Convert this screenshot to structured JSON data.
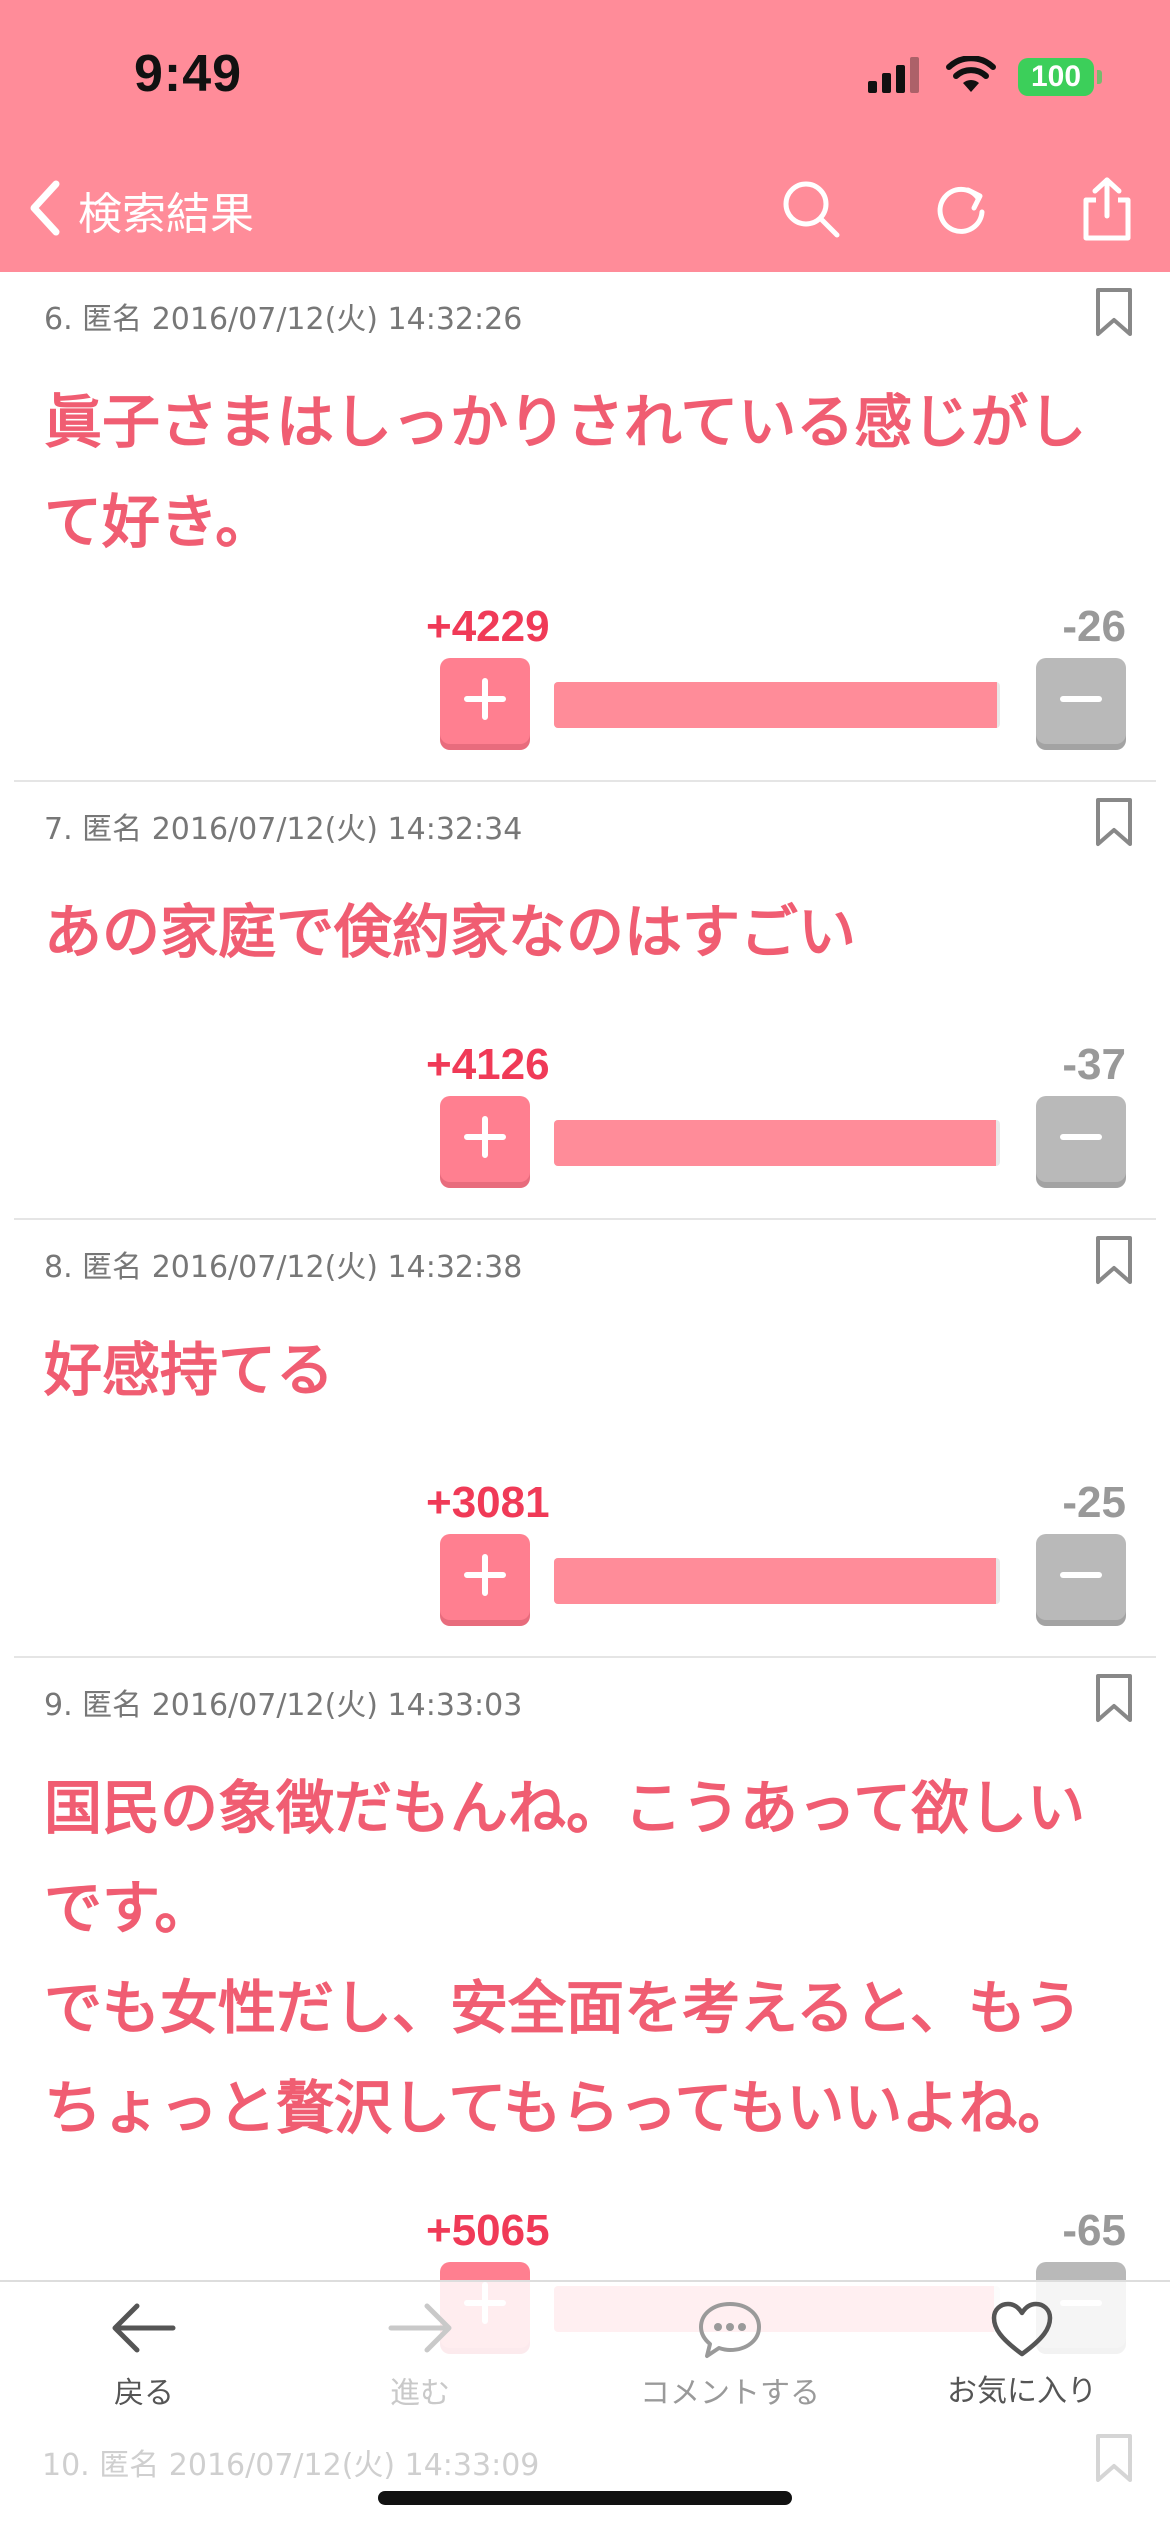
{
  "status": {
    "time": "9:49",
    "battery": "100"
  },
  "nav": {
    "back_title": "検索結果"
  },
  "comments": [
    {
      "meta": "6. 匿名 2016/07/12(火) 14:32:26",
      "text": "眞子さまはしっかりされている感じがして好き。",
      "plus": "+4229",
      "minus": "-26",
      "ratio": 0.994
    },
    {
      "meta": "7. 匿名 2016/07/12(火) 14:32:34",
      "text": "あの家庭で倹約家なのはすごい",
      "plus": "+4126",
      "minus": "-37",
      "ratio": 0.991
    },
    {
      "meta": "8. 匿名 2016/07/12(火) 14:32:38",
      "text": "好感持てる",
      "plus": "+3081",
      "minus": "-25",
      "ratio": 0.992
    },
    {
      "meta": "9. 匿名 2016/07/12(火) 14:33:03",
      "text": "国民の象徴だもんね。こうあって欲しいです。\nでも女性だし、安全面を考えると、もうちょっと贅沢してもらってもいいよね。",
      "plus": "+5065",
      "minus": "-65",
      "ratio": 0.987
    }
  ],
  "peek": {
    "meta": "10. 匿名 2016/07/12(火) 14:33:09"
  },
  "toolbar": {
    "back": "戻る",
    "forward": "進む",
    "comment": "コメントする",
    "favorite": "お気に入り"
  }
}
